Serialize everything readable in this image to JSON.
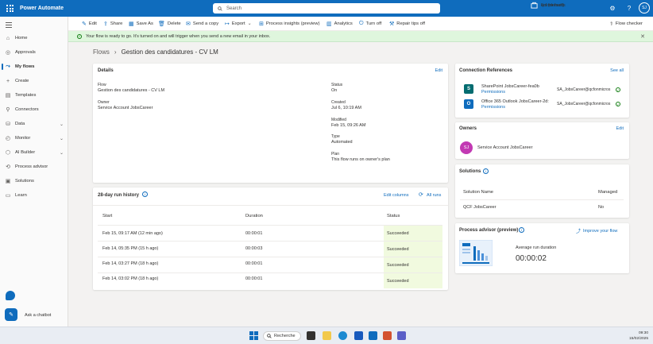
{
  "app": {
    "title": "Power Automate"
  },
  "search": {
    "placeholder": "Search"
  },
  "environment": {
    "label": "Environments",
    "value": "qcf (default)"
  },
  "user": {
    "initials": "SJ"
  },
  "sidebar": {
    "items": [
      {
        "label": "Home",
        "icon": "home-icon"
      },
      {
        "label": "Approvals",
        "icon": "approvals-icon"
      },
      {
        "label": "My flows",
        "icon": "flows-icon",
        "active": true
      },
      {
        "label": "Create",
        "icon": "plus-icon"
      },
      {
        "label": "Templates",
        "icon": "templates-icon"
      },
      {
        "label": "Connectors",
        "icon": "connectors-icon"
      },
      {
        "label": "Data",
        "icon": "data-icon",
        "expandable": true
      },
      {
        "label": "Monitor",
        "icon": "monitor-icon",
        "expandable": true
      },
      {
        "label": "AI Builder",
        "icon": "ai-builder-icon",
        "expandable": true
      },
      {
        "label": "Process advisor",
        "icon": "process-advisor-icon"
      },
      {
        "label": "Solutions",
        "icon": "solutions-icon"
      },
      {
        "label": "Learn",
        "icon": "learn-icon"
      }
    ],
    "chatbot_label": "Ask a chatbot"
  },
  "commands": {
    "edit": "Edit",
    "share": "Share",
    "save_as": "Save As",
    "delete": "Delete",
    "send_copy": "Send a copy",
    "export": "Export",
    "process_insights": "Process insights (preview)",
    "analytics": "Analytics",
    "turn_off": "Turn off",
    "repair_tips": "Repair tips off",
    "flow_checker": "Flow checker"
  },
  "banner": {
    "text": "Your flow is ready to go. It's turned on and will trigger when you send a new email in your inbox."
  },
  "breadcrumb": {
    "parent": "Flows",
    "current": "Gestion des candidatures - CV LM"
  },
  "details": {
    "title": "Details",
    "edit": "Edit",
    "flow_label": "Flow",
    "flow_value": "Gestion des candidatures - CV LM",
    "owner_label": "Owner",
    "owner_value": "Service Account JobsCareer",
    "status_label": "Status",
    "status_value": "On",
    "created_label": "Created",
    "created_value": "Jul 6, 10:19 AM",
    "modified_label": "Modified",
    "modified_value": "Feb 15, 09:26 AM",
    "type_label": "Type",
    "type_value": "Automated",
    "plan_label": "Plan",
    "plan_value": "This flow runs on owner's plan"
  },
  "run_history": {
    "title": "28-day run history",
    "edit_columns": "Edit columns",
    "all_runs": "All runs",
    "columns": [
      "Start",
      "Duration",
      "Status"
    ],
    "rows": [
      {
        "start": "Feb 15, 09:17 AM (12 min ago)",
        "duration": "00:00:01",
        "status": "Succeeded"
      },
      {
        "start": "Feb 14, 05:35 PM (15 h ago)",
        "duration": "00:00:03",
        "status": "Succeeded"
      },
      {
        "start": "Feb 14, 03:27 PM (18 h ago)",
        "duration": "00:00:01",
        "status": "Succeeded"
      },
      {
        "start": "Feb 14, 03:02 PM (18 h ago)",
        "duration": "00:00:01",
        "status": "Succeeded"
      }
    ]
  },
  "connections": {
    "title": "Connection References",
    "see_all": "See all",
    "items": [
      {
        "name": "SharePoint JobsCareer-fea0b",
        "permissions": "Permissions",
        "account": "SA_JobsCareer@qcfonmicros",
        "color": "#036c70"
      },
      {
        "name": "Office 365 Outlook JobsCareer-2d:",
        "permissions": "Permissions",
        "account": "SA_JobsCareer@qcfonmicros",
        "color": "#0f6cbd"
      }
    ]
  },
  "owners": {
    "title": "Owners",
    "edit": "Edit",
    "initials": "SJ",
    "name": "Service Account JobsCareer"
  },
  "solutions": {
    "title": "Solutions",
    "col_name": "Solution Name",
    "col_managed": "Managed",
    "row_name": "QCF JobsCareer",
    "row_managed": "No"
  },
  "process_advisor": {
    "title": "Process advisor (preview)",
    "improve": "Improve your flow",
    "metric_label": "Average run duration",
    "metric_value": "00:00:02"
  },
  "taskbar": {
    "search": "Recherche",
    "time": "09:30",
    "date": "15/02/2025"
  }
}
